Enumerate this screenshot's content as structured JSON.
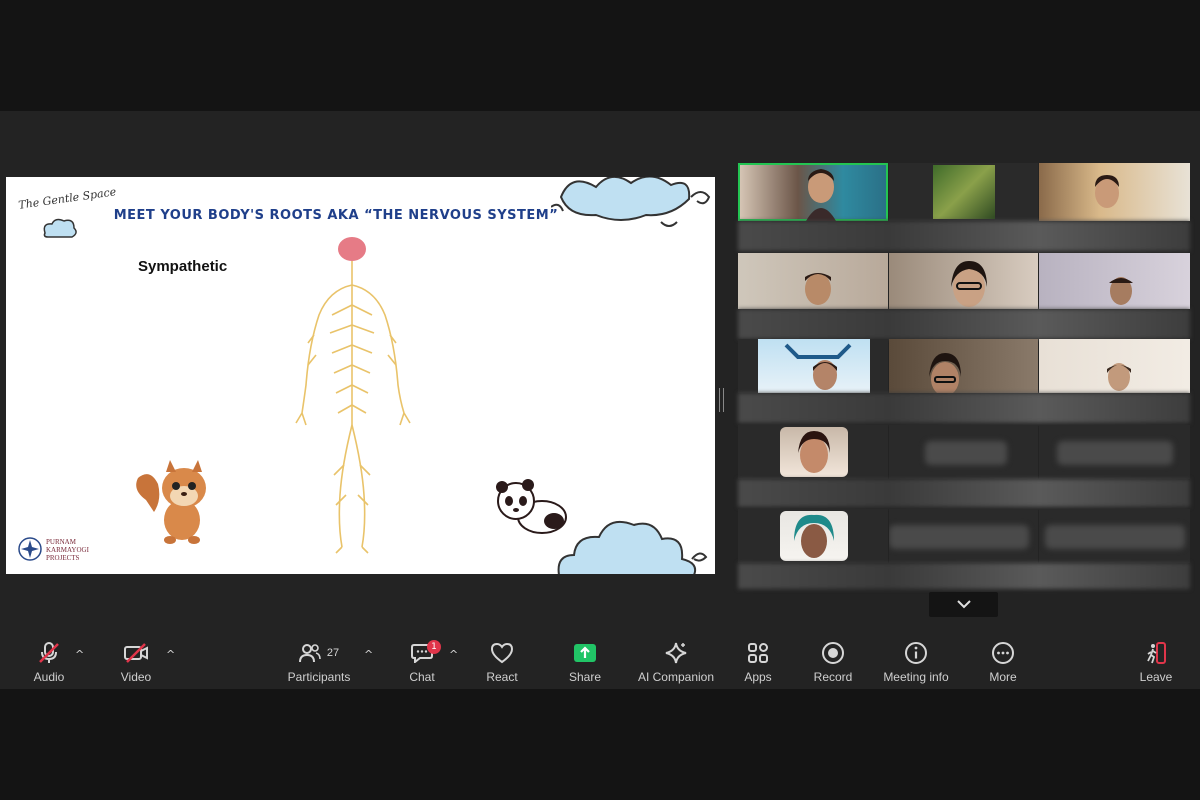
{
  "slide": {
    "title": "MEET YOUR BODY'S ROOTS AKA “THE NERVOUS SYSTEM”",
    "subtitle": "Sympathetic",
    "logo_text": "The Gentle Space",
    "brand_line1": "PURNAM",
    "brand_line2": "KARMAYOGI",
    "brand_line3": "PROJECTS"
  },
  "toolbar": {
    "audio_label": "Audio",
    "video_label": "Video",
    "participants_label": "Participants",
    "participants_count": "27",
    "chat_label": "Chat",
    "chat_badge": "1",
    "react_label": "React",
    "share_label": "Share",
    "ai_label": "AI Companion",
    "apps_label": "Apps",
    "record_label": "Record",
    "info_label": "Meeting info",
    "more_label": "More",
    "leave_label": "Leave"
  },
  "colors": {
    "accent_green": "#23c552",
    "share_green": "#21c466",
    "badge_red": "#e0354a",
    "leave_red": "#e0354a",
    "slide_title_blue": "#1f3f8a"
  },
  "icons": {
    "audio": "microphone-muted-icon",
    "video": "camera-off-icon",
    "participants": "people-icon",
    "chat": "chat-bubble-icon",
    "react": "heart-icon",
    "share": "share-screen-icon",
    "ai": "sparkle-icon",
    "apps": "apps-icon",
    "record": "record-icon",
    "info": "info-icon",
    "more": "more-icon",
    "leave": "leave-icon",
    "scroll": "chevron-down-icon"
  }
}
